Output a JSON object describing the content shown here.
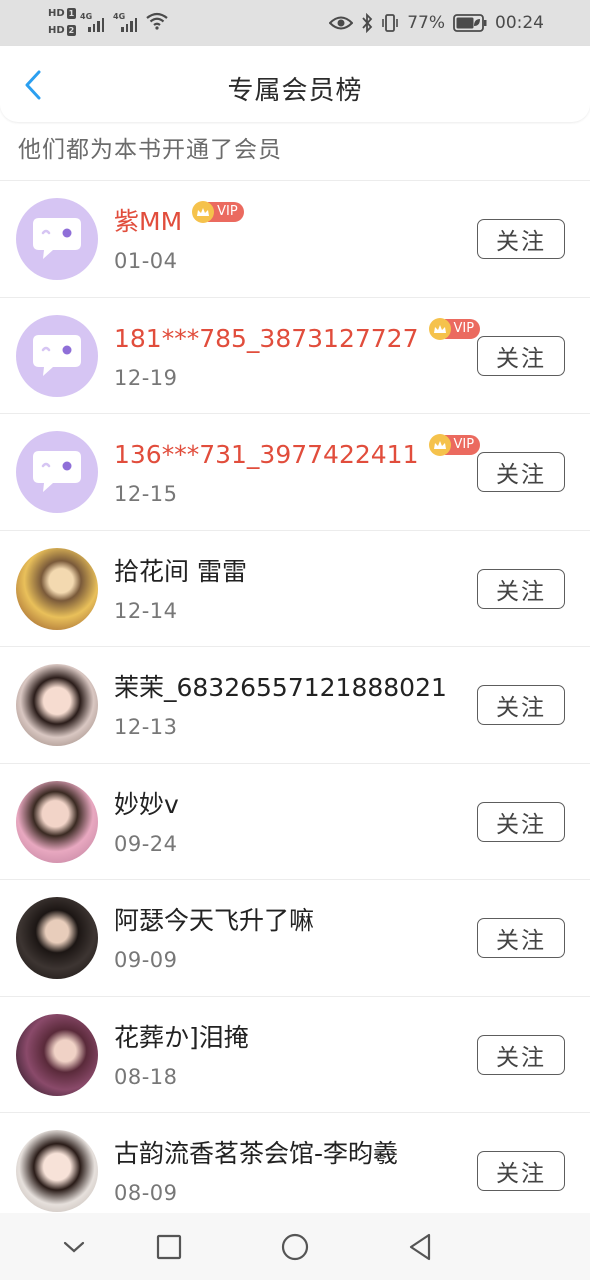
{
  "status_bar": {
    "hd1": "HD",
    "hd1_digit": "1",
    "hd2": "HD",
    "hd2_digit": "2",
    "net1": "4G",
    "net2": "4G",
    "battery": "77%",
    "time": "00:24",
    "icons": [
      "eye-icon",
      "bluetooth-icon",
      "vibrate-icon",
      "battery-icon"
    ]
  },
  "header": {
    "title": "专属会员榜",
    "back_icon": "chevron-left-icon",
    "accent_color": "#2b9ff0"
  },
  "subtitle": "他们都为本书开通了会员",
  "vip": {
    "label": "VIP",
    "name_color": "#e14d3c"
  },
  "follow_label": "关注",
  "members": [
    {
      "name": "紫MM",
      "date": "01-04",
      "vip": true,
      "avatar": "default-avatar"
    },
    {
      "name": "181***785_3873127727",
      "date": "12-19",
      "vip": true,
      "avatar": "default-avatar"
    },
    {
      "name": "136***731_3977422411",
      "date": "12-15",
      "vip": true,
      "avatar": "default-avatar"
    },
    {
      "name": "拾花间 雷雷",
      "date": "12-14",
      "vip": false,
      "avatar": "photo"
    },
    {
      "name": "茉茉_68326557121888021",
      "date": "12-13",
      "vip": false,
      "avatar": "photo"
    },
    {
      "name": "妙妙v",
      "date": "09-24",
      "vip": false,
      "avatar": "photo"
    },
    {
      "name": "阿瑟今天飞升了嘛",
      "date": "09-09",
      "vip": false,
      "avatar": "photo"
    },
    {
      "name": "花葬か]泪掩",
      "date": "08-18",
      "vip": false,
      "avatar": "photo"
    },
    {
      "name": "古韵流香茗茶会馆-李昀羲",
      "date": "08-09",
      "vip": false,
      "avatar": "photo"
    }
  ],
  "nav_bar": {
    "buttons": [
      "chevron-down-icon",
      "square-icon",
      "circle-icon",
      "triangle-back-icon"
    ]
  }
}
